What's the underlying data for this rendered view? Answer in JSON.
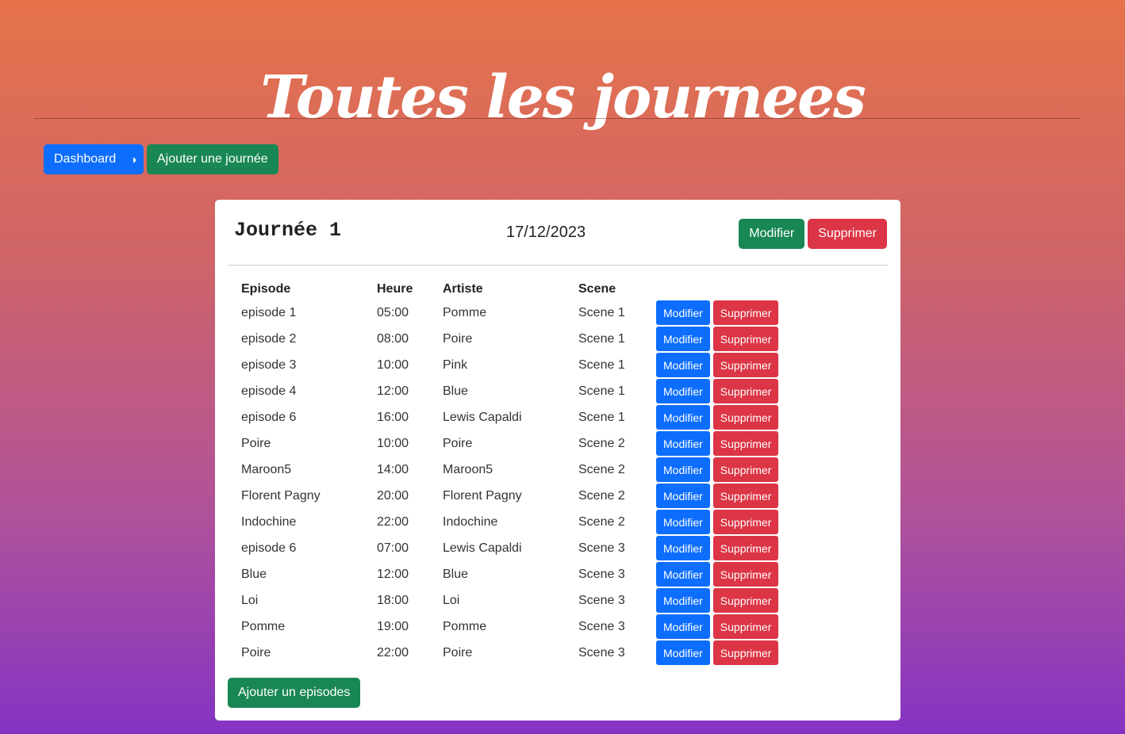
{
  "page": {
    "title": "Toutes les journees"
  },
  "nav": {
    "dashboard_label": "Dashboard",
    "add_day_label": "Ajouter une journée"
  },
  "day": {
    "title": "Journée 1",
    "date": "17/12/2023",
    "edit_label": "Modifier",
    "delete_label": "Supprimer",
    "add_episode_label": "Ajouter un episodes"
  },
  "table": {
    "headers": [
      "Episode",
      "Heure",
      "Artiste",
      "Scene"
    ],
    "row_edit_label": "Modifier",
    "row_delete_label": "Supprimer",
    "rows": [
      {
        "episode": "episode 1",
        "heure": "05:00",
        "artiste": "Pomme",
        "scene": "Scene 1"
      },
      {
        "episode": "episode 2",
        "heure": "08:00",
        "artiste": "Poire",
        "scene": "Scene 1"
      },
      {
        "episode": "episode 3",
        "heure": "10:00",
        "artiste": "Pink",
        "scene": "Scene 1"
      },
      {
        "episode": "episode 4",
        "heure": "12:00",
        "artiste": "Blue",
        "scene": "Scene 1"
      },
      {
        "episode": "episode 6",
        "heure": "16:00",
        "artiste": "Lewis Capaldi",
        "scene": "Scene 1"
      },
      {
        "episode": "Poire",
        "heure": "10:00",
        "artiste": "Poire",
        "scene": "Scene 2"
      },
      {
        "episode": "Maroon5",
        "heure": "14:00",
        "artiste": "Maroon5",
        "scene": "Scene 2"
      },
      {
        "episode": "Florent Pagny",
        "heure": "20:00",
        "artiste": "Florent Pagny",
        "scene": "Scene 2"
      },
      {
        "episode": "Indochine",
        "heure": "22:00",
        "artiste": "Indochine",
        "scene": "Scene 2"
      },
      {
        "episode": "episode 6",
        "heure": "07:00",
        "artiste": "Lewis Capaldi",
        "scene": "Scene 3"
      },
      {
        "episode": "Blue",
        "heure": "12:00",
        "artiste": "Blue",
        "scene": "Scene 3"
      },
      {
        "episode": "Loi",
        "heure": "18:00",
        "artiste": "Loi",
        "scene": "Scene 3"
      },
      {
        "episode": "Pomme",
        "heure": "19:00",
        "artiste": "Pomme",
        "scene": "Scene 3"
      },
      {
        "episode": "Poire",
        "heure": "22:00",
        "artiste": "Poire",
        "scene": "Scene 3"
      }
    ]
  },
  "icons": {
    "dashboard_toggle": "caret-right-icon"
  },
  "colors": {
    "primary": "#0d6efd",
    "success": "#198754",
    "danger": "#dc3545",
    "gradient_top": "#e6734a",
    "gradient_bottom": "#8433c4"
  }
}
